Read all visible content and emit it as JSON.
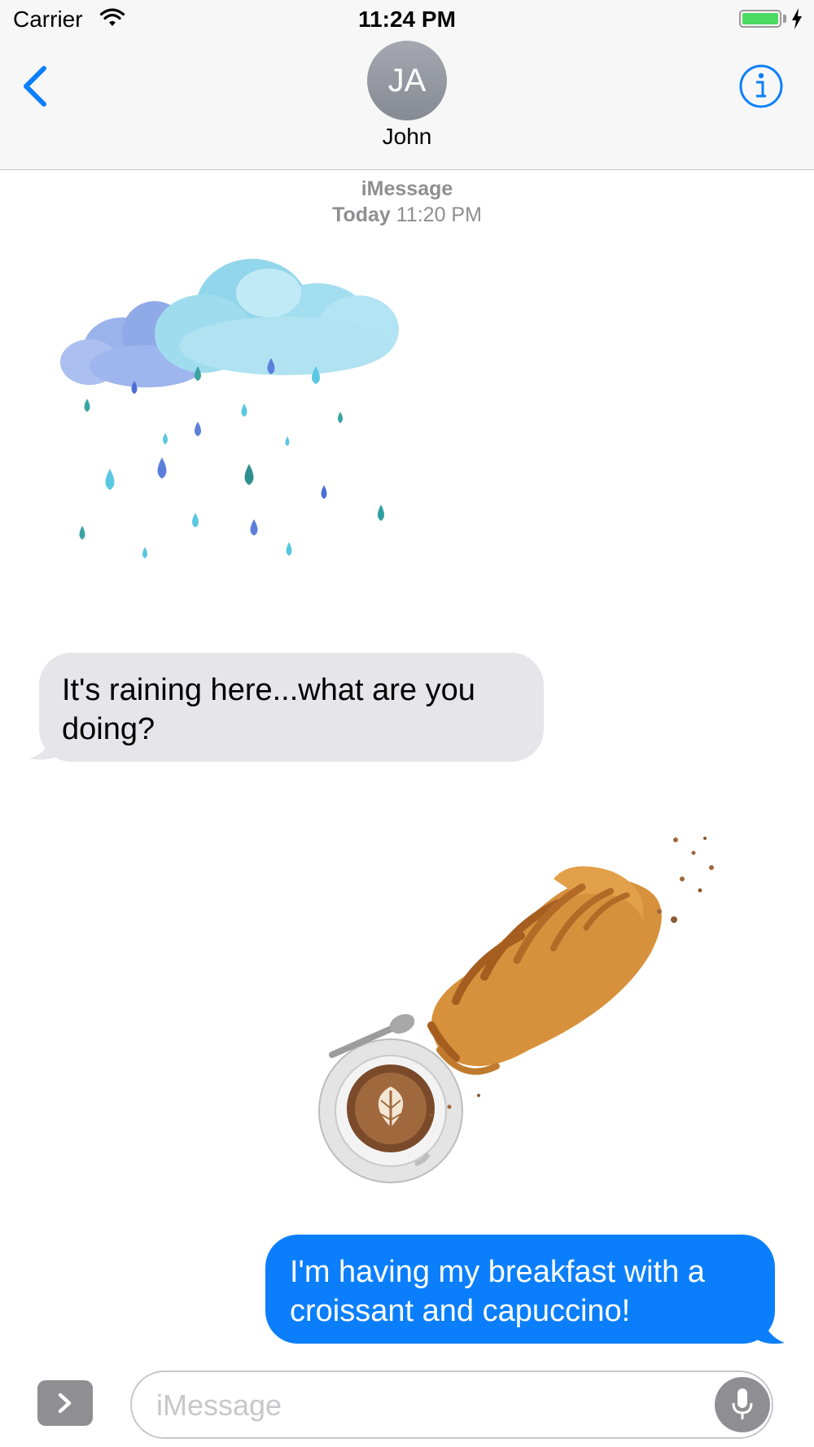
{
  "status_bar": {
    "carrier": "Carrier",
    "time": "11:24 PM",
    "battery_level": 1.0,
    "battery_color": "#4cd964",
    "icons": [
      "wifi-icon",
      "battery-icon",
      "charging-bolt-icon"
    ]
  },
  "header": {
    "avatar_initials": "JA",
    "contact_name": "John",
    "back_icon": "chevron-left-icon",
    "info_icon": "info-icon",
    "accent_color": "#0b7ffb"
  },
  "thread": {
    "service": "iMessage",
    "date_label": "Today",
    "date_time": "11:20 PM",
    "messages": [
      {
        "direction": "incoming",
        "sticker": "rain-cloud-sticker",
        "text": "It's raining here...what are you doing?"
      },
      {
        "direction": "outgoing",
        "sticker": "croissant-cappuccino-sticker",
        "text": "I'm having my breakfast with a croissant and capuccino!"
      }
    ]
  },
  "input_bar": {
    "placeholder": "iMessage",
    "value": "",
    "apps_icon": "chevron-right-icon",
    "mic_icon": "microphone-icon"
  }
}
